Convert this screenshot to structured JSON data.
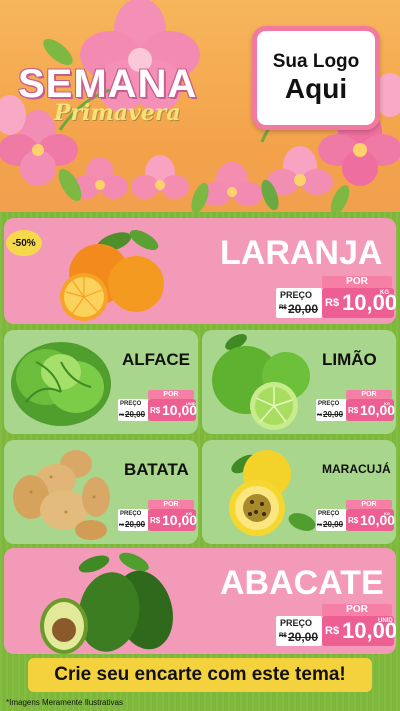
{
  "header": {
    "title_main": "SEMANA",
    "title_sub": "Primavera",
    "logo_line1": "Sua Logo",
    "logo_line2": "Aqui"
  },
  "badge": "-50%",
  "products": [
    {
      "name": "LARANJA",
      "por": "POR",
      "preco_label": "PREÇO",
      "old_price_prefix": "R$",
      "old_price": "20,00",
      "rs": "R$",
      "price": "10,00",
      "unit": "KG"
    },
    {
      "name": "ALFACE",
      "por": "POR",
      "preco_label": "PREÇO",
      "old_price_prefix": "R$",
      "old_price": "20,00",
      "rs": "R$",
      "price": "10,00",
      "unit": "UNID"
    },
    {
      "name": "LIMÃO",
      "por": "POR",
      "preco_label": "PREÇO",
      "old_price_prefix": "R$",
      "old_price": "20,00",
      "rs": "R$",
      "price": "10,00",
      "unit": "KG"
    },
    {
      "name": "BATATA",
      "por": "POR",
      "preco_label": "PREÇO",
      "old_price_prefix": "R$",
      "old_price": "20,00",
      "rs": "R$",
      "price": "10,00",
      "unit": "KG"
    },
    {
      "name": "MARACUJÁ",
      "por": "POR",
      "preco_label": "PREÇO",
      "old_price_prefix": "R$",
      "old_price": "20,00",
      "rs": "R$",
      "price": "10,00",
      "unit": "KG"
    },
    {
      "name": "ABACATE",
      "por": "POR",
      "preco_label": "PREÇO",
      "old_price_prefix": "R$",
      "old_price": "20,00",
      "rs": "R$",
      "price": "10,00",
      "unit": "UNID"
    }
  ],
  "cta": "Crie seu encarte com este tema!",
  "footnote": "*Imagens Meramente Ilustrativas",
  "colors": {
    "pink": "#f39ab8",
    "hot_pink": "#ed5f92",
    "green": "#7db83a",
    "light_green": "#a8d68c",
    "yellow": "#f4d23e",
    "orange": "#f7b65c"
  }
}
